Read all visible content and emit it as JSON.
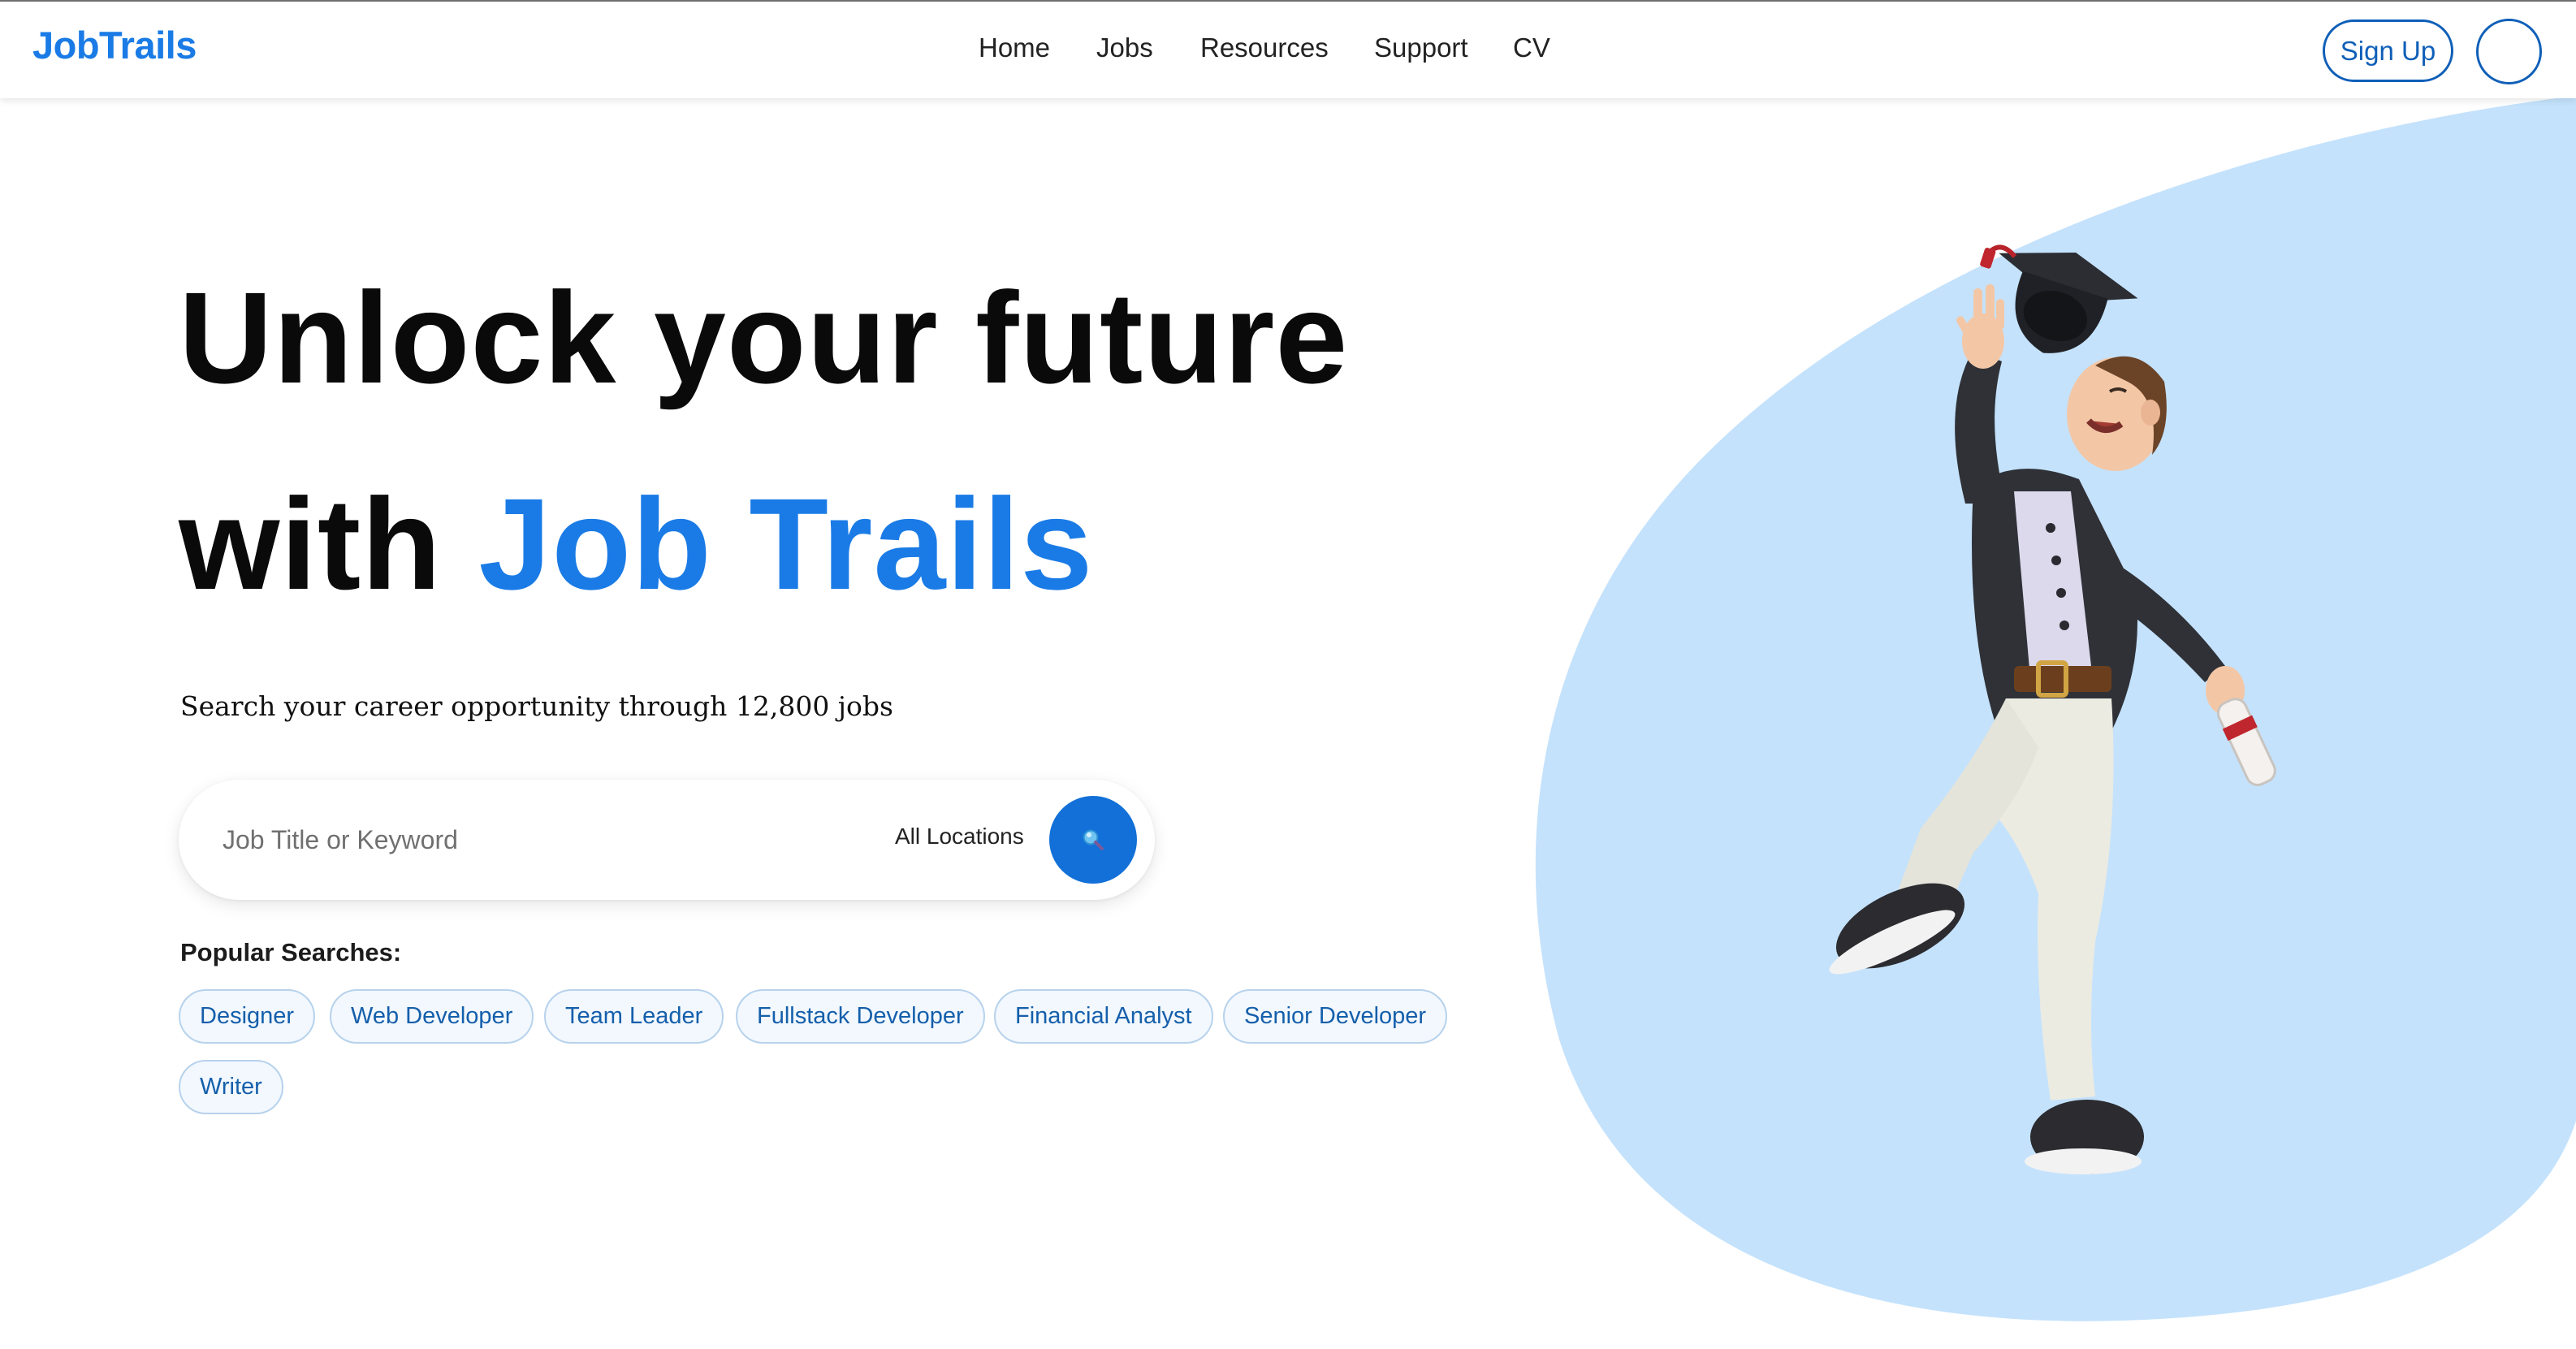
{
  "brand": {
    "name": "JobTrails",
    "color": "#1a7be6"
  },
  "nav": {
    "items": [
      "Home",
      "Jobs",
      "Resources",
      "Support",
      "CV"
    ],
    "signup_label": "Sign Up"
  },
  "hero": {
    "headline_line1": "Unlock your future",
    "headline_line2_prefix": "with ",
    "headline_line2_accent": "Job Trails",
    "subtitle": "Search your career opportunity through 12,800 jobs",
    "background_color": "#c4e2fc"
  },
  "search": {
    "placeholder": "Job Title or Keyword",
    "location_label": "All Locations",
    "button_icon": "search-icon",
    "button_color": "#1270d8"
  },
  "popular": {
    "title": "Popular Searches:",
    "tags": [
      "Designer",
      "Web Developer",
      "Team Leader",
      "Fullstack Developer",
      "Financial Analyst",
      "Senior Developer",
      "Writer"
    ]
  },
  "illustration": {
    "subject": "graduate-character-illustration"
  }
}
